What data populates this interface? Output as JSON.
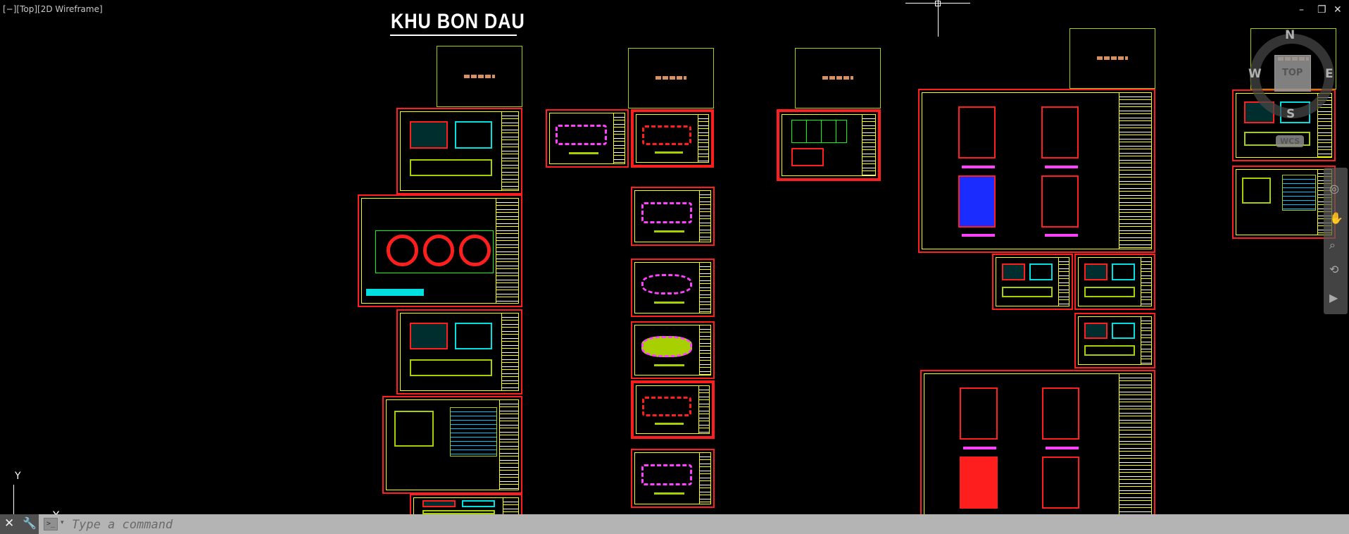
{
  "viewport": {
    "label": "[−][Top][2D Wireframe]",
    "drawing_title": "KHU BON DAU"
  },
  "window_controls": {
    "minimize": "–",
    "restore": "❐",
    "close": "✕"
  },
  "viewcube": {
    "north": "N",
    "south": "S",
    "east": "E",
    "west": "W",
    "face": "TOP",
    "ucs": "WCS"
  },
  "ucs_icon": {
    "y_label": "Y",
    "x_label": "X"
  },
  "command_line": {
    "placeholder": "Type a command",
    "close_icon": "✕",
    "customize_icon": "🔧",
    "prompt_icon": ">_",
    "dropdown_icon": "▾"
  },
  "colors": {
    "background": "#000000",
    "sheet_border": "#ff1e1e",
    "inner_border": "#ffff00",
    "header_frame": "#a8d000",
    "command_bar": "#b4b4b4"
  }
}
